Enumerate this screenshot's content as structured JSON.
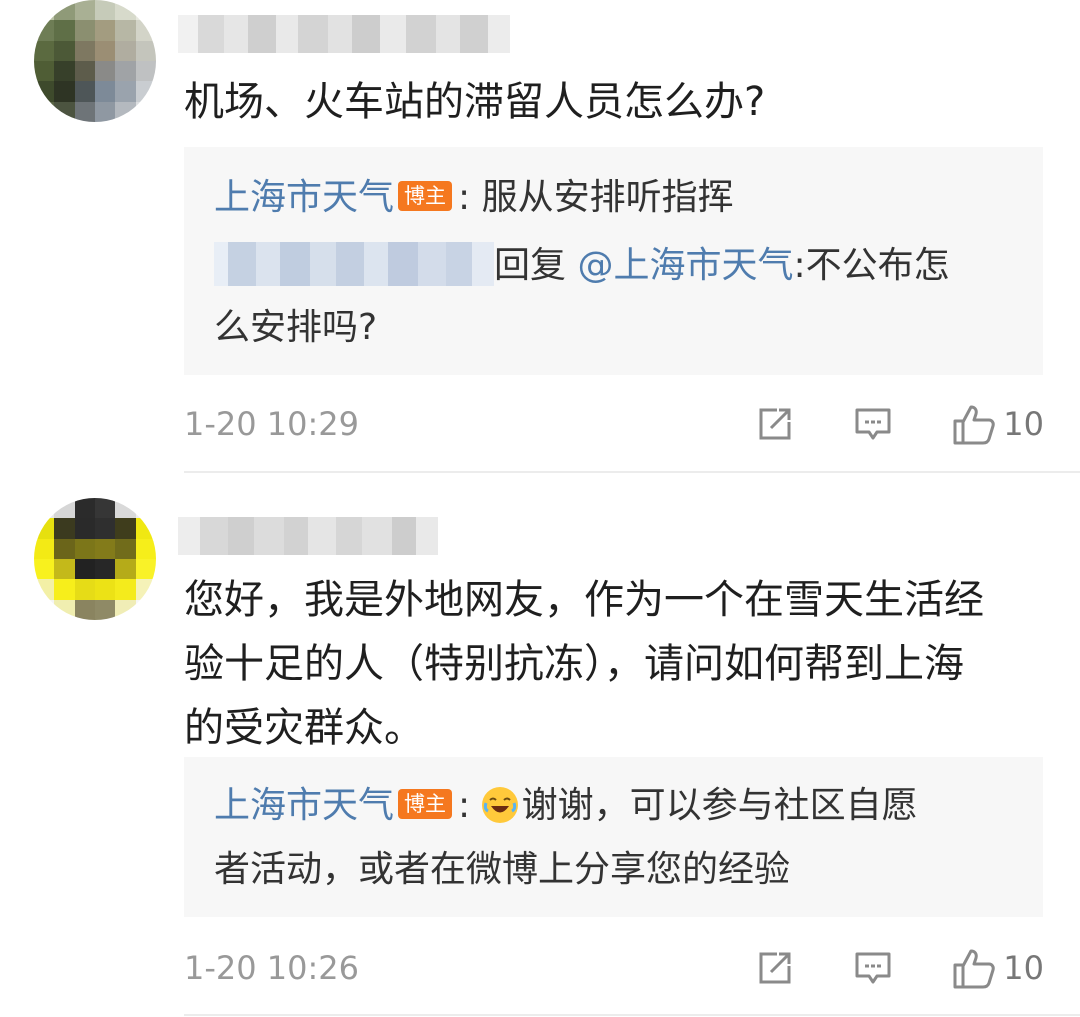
{
  "comments": [
    {
      "text": "机场、火车站的滞留人员怎么办?",
      "reply": {
        "author": "上海市天气",
        "badge": "博主",
        "separator": ":",
        "text": "服从安排听指挥",
        "sub_reply_prefix": "回复",
        "mention": "@上海市天气",
        "sub_reply_text_1": ":不公布怎",
        "sub_reply_text_2": "么安排吗?"
      },
      "time": "1-20 10:29",
      "likes": "10"
    },
    {
      "text_lines": [
        "您好，我是外地网友，作为一个在雪天生活经",
        "验十足的人（特别抗冻），请问如何帮到上海",
        "的受灾群众。"
      ],
      "reply": {
        "author": "上海市天气",
        "badge": "博主",
        "separator": ":",
        "text_line_1": "谢谢，可以参与社区自愿",
        "text_line_2": "者活动，或者在微博上分享您的经验"
      },
      "time": "1-20 10:26",
      "likes": "10"
    }
  ],
  "icons": {
    "repost": "repost-icon",
    "comment": "comment-icon",
    "like": "thumbs-up-icon",
    "emoji": "laughing-tears-emoji-icon"
  },
  "colors": {
    "link": "#4f7cae",
    "badge": "#f5781f",
    "meta": "#999999",
    "reply_bg": "#f7f7f7"
  }
}
